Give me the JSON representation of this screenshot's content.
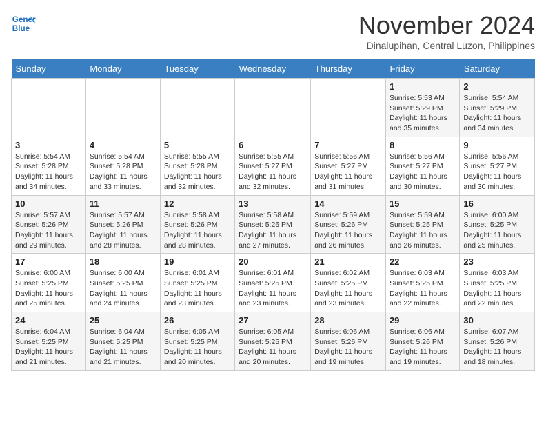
{
  "header": {
    "logo_line1": "General",
    "logo_line2": "Blue",
    "month": "November 2024",
    "location": "Dinalupihan, Central Luzon, Philippines"
  },
  "days_of_week": [
    "Sunday",
    "Monday",
    "Tuesday",
    "Wednesday",
    "Thursday",
    "Friday",
    "Saturday"
  ],
  "weeks": [
    [
      {
        "day": "",
        "sunrise": "",
        "sunset": "",
        "daylight": ""
      },
      {
        "day": "",
        "sunrise": "",
        "sunset": "",
        "daylight": ""
      },
      {
        "day": "",
        "sunrise": "",
        "sunset": "",
        "daylight": ""
      },
      {
        "day": "",
        "sunrise": "",
        "sunset": "",
        "daylight": ""
      },
      {
        "day": "",
        "sunrise": "",
        "sunset": "",
        "daylight": ""
      },
      {
        "day": "1",
        "sunrise": "Sunrise: 5:53 AM",
        "sunset": "Sunset: 5:29 PM",
        "daylight": "Daylight: 11 hours and 35 minutes."
      },
      {
        "day": "2",
        "sunrise": "Sunrise: 5:54 AM",
        "sunset": "Sunset: 5:29 PM",
        "daylight": "Daylight: 11 hours and 34 minutes."
      }
    ],
    [
      {
        "day": "3",
        "sunrise": "Sunrise: 5:54 AM",
        "sunset": "Sunset: 5:28 PM",
        "daylight": "Daylight: 11 hours and 34 minutes."
      },
      {
        "day": "4",
        "sunrise": "Sunrise: 5:54 AM",
        "sunset": "Sunset: 5:28 PM",
        "daylight": "Daylight: 11 hours and 33 minutes."
      },
      {
        "day": "5",
        "sunrise": "Sunrise: 5:55 AM",
        "sunset": "Sunset: 5:28 PM",
        "daylight": "Daylight: 11 hours and 32 minutes."
      },
      {
        "day": "6",
        "sunrise": "Sunrise: 5:55 AM",
        "sunset": "Sunset: 5:27 PM",
        "daylight": "Daylight: 11 hours and 32 minutes."
      },
      {
        "day": "7",
        "sunrise": "Sunrise: 5:56 AM",
        "sunset": "Sunset: 5:27 PM",
        "daylight": "Daylight: 11 hours and 31 minutes."
      },
      {
        "day": "8",
        "sunrise": "Sunrise: 5:56 AM",
        "sunset": "Sunset: 5:27 PM",
        "daylight": "Daylight: 11 hours and 30 minutes."
      },
      {
        "day": "9",
        "sunrise": "Sunrise: 5:56 AM",
        "sunset": "Sunset: 5:27 PM",
        "daylight": "Daylight: 11 hours and 30 minutes."
      }
    ],
    [
      {
        "day": "10",
        "sunrise": "Sunrise: 5:57 AM",
        "sunset": "Sunset: 5:26 PM",
        "daylight": "Daylight: 11 hours and 29 minutes."
      },
      {
        "day": "11",
        "sunrise": "Sunrise: 5:57 AM",
        "sunset": "Sunset: 5:26 PM",
        "daylight": "Daylight: 11 hours and 28 minutes."
      },
      {
        "day": "12",
        "sunrise": "Sunrise: 5:58 AM",
        "sunset": "Sunset: 5:26 PM",
        "daylight": "Daylight: 11 hours and 28 minutes."
      },
      {
        "day": "13",
        "sunrise": "Sunrise: 5:58 AM",
        "sunset": "Sunset: 5:26 PM",
        "daylight": "Daylight: 11 hours and 27 minutes."
      },
      {
        "day": "14",
        "sunrise": "Sunrise: 5:59 AM",
        "sunset": "Sunset: 5:26 PM",
        "daylight": "Daylight: 11 hours and 26 minutes."
      },
      {
        "day": "15",
        "sunrise": "Sunrise: 5:59 AM",
        "sunset": "Sunset: 5:25 PM",
        "daylight": "Daylight: 11 hours and 26 minutes."
      },
      {
        "day": "16",
        "sunrise": "Sunrise: 6:00 AM",
        "sunset": "Sunset: 5:25 PM",
        "daylight": "Daylight: 11 hours and 25 minutes."
      }
    ],
    [
      {
        "day": "17",
        "sunrise": "Sunrise: 6:00 AM",
        "sunset": "Sunset: 5:25 PM",
        "daylight": "Daylight: 11 hours and 25 minutes."
      },
      {
        "day": "18",
        "sunrise": "Sunrise: 6:00 AM",
        "sunset": "Sunset: 5:25 PM",
        "daylight": "Daylight: 11 hours and 24 minutes."
      },
      {
        "day": "19",
        "sunrise": "Sunrise: 6:01 AM",
        "sunset": "Sunset: 5:25 PM",
        "daylight": "Daylight: 11 hours and 23 minutes."
      },
      {
        "day": "20",
        "sunrise": "Sunrise: 6:01 AM",
        "sunset": "Sunset: 5:25 PM",
        "daylight": "Daylight: 11 hours and 23 minutes."
      },
      {
        "day": "21",
        "sunrise": "Sunrise: 6:02 AM",
        "sunset": "Sunset: 5:25 PM",
        "daylight": "Daylight: 11 hours and 23 minutes."
      },
      {
        "day": "22",
        "sunrise": "Sunrise: 6:03 AM",
        "sunset": "Sunset: 5:25 PM",
        "daylight": "Daylight: 11 hours and 22 minutes."
      },
      {
        "day": "23",
        "sunrise": "Sunrise: 6:03 AM",
        "sunset": "Sunset: 5:25 PM",
        "daylight": "Daylight: 11 hours and 22 minutes."
      }
    ],
    [
      {
        "day": "24",
        "sunrise": "Sunrise: 6:04 AM",
        "sunset": "Sunset: 5:25 PM",
        "daylight": "Daylight: 11 hours and 21 minutes."
      },
      {
        "day": "25",
        "sunrise": "Sunrise: 6:04 AM",
        "sunset": "Sunset: 5:25 PM",
        "daylight": "Daylight: 11 hours and 21 minutes."
      },
      {
        "day": "26",
        "sunrise": "Sunrise: 6:05 AM",
        "sunset": "Sunset: 5:25 PM",
        "daylight": "Daylight: 11 hours and 20 minutes."
      },
      {
        "day": "27",
        "sunrise": "Sunrise: 6:05 AM",
        "sunset": "Sunset: 5:25 PM",
        "daylight": "Daylight: 11 hours and 20 minutes."
      },
      {
        "day": "28",
        "sunrise": "Sunrise: 6:06 AM",
        "sunset": "Sunset: 5:26 PM",
        "daylight": "Daylight: 11 hours and 19 minutes."
      },
      {
        "day": "29",
        "sunrise": "Sunrise: 6:06 AM",
        "sunset": "Sunset: 5:26 PM",
        "daylight": "Daylight: 11 hours and 19 minutes."
      },
      {
        "day": "30",
        "sunrise": "Sunrise: 6:07 AM",
        "sunset": "Sunset: 5:26 PM",
        "daylight": "Daylight: 11 hours and 18 minutes."
      }
    ]
  ]
}
